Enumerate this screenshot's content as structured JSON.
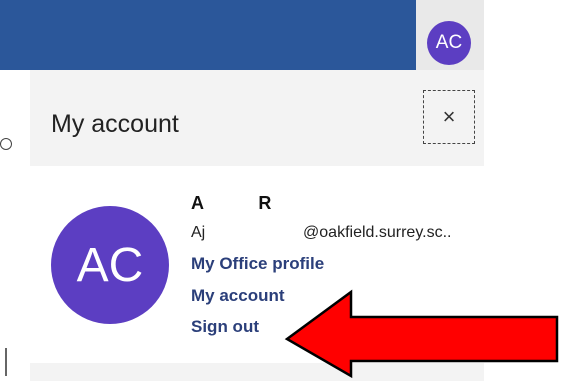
{
  "header": {
    "avatar_initials": "AC"
  },
  "panel": {
    "title": "My account",
    "close_label": "×",
    "user": {
      "initials": "AC",
      "name": "A           R",
      "email": "Aj                      @oakfield.surrey.sc..",
      "links": [
        "My Office profile",
        "My account",
        "Sign out"
      ]
    }
  },
  "colors": {
    "topbar": "#2b579a",
    "avatar": "#5c3ec2",
    "arrow_fill": "#ff0000",
    "link": "#2b3f7a"
  },
  "annotation": {
    "icon": "red-arrow-icon"
  }
}
